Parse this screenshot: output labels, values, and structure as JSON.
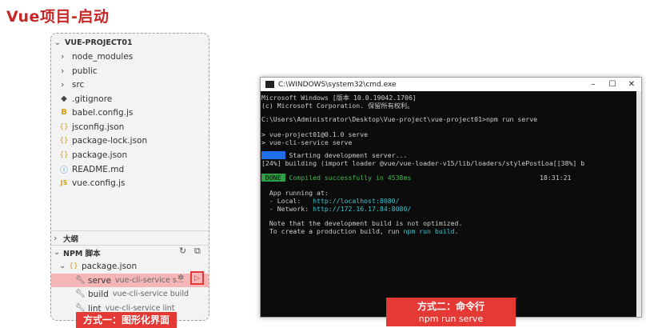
{
  "slide_title": "Vue项目-启动",
  "explorer": {
    "project": "VUE-PROJECT01",
    "items": [
      {
        "label": "node_modules",
        "icon": "›"
      },
      {
        "label": "public",
        "icon": "›"
      },
      {
        "label": "src",
        "icon": "›"
      },
      {
        "label": ".gitignore",
        "icon": "◆"
      },
      {
        "label": "babel.config.js",
        "icon": "B"
      },
      {
        "label": "jsconfig.json",
        "icon": "{}"
      },
      {
        "label": "package-lock.json",
        "icon": "{}"
      },
      {
        "label": "package.json",
        "icon": "{}"
      },
      {
        "label": "README.md",
        "icon": "ⓘ"
      },
      {
        "label": "vue.config.js",
        "icon": "JS"
      }
    ],
    "outline": "大纲",
    "npm_scripts": "NPM 脚本",
    "package_json": "package.json",
    "scripts": [
      {
        "name": "serve",
        "cmd": "vue-cli-service s..."
      },
      {
        "name": "build",
        "cmd": "vue-cli-service build"
      },
      {
        "name": "lint",
        "cmd": "vue-cli-service lint"
      }
    ]
  },
  "labels": {
    "gui": "方式一：图形化界面",
    "cli_title": "方式二：命令行",
    "cli_sub": "npm run serve"
  },
  "cmd_window": {
    "title": "C:\\WINDOWS\\system32\\cmd.exe",
    "lines": {
      "l1": "Microsoft Windows [版本 10.0.19042.1706]",
      "l2": "(c) Microsoft Corporation. 保留所有权利。",
      "l3": "C:\\Users\\Administrator\\Desktop\\Vue-project\\vue-project01>npm run serve",
      "l4": "> vue-project01@0.1.0 serve",
      "l5": "> vue-cli-service serve",
      "l6a": " INFO ",
      "l6b": " Starting development server...",
      "l7": "[24%] building (import loader @vue/vue-loader-v15/lib/loaders/stylePostLoa[[38%] b",
      "l8a": " DONE ",
      "l8b": " Compiled successfully in 4538ms",
      "l8c": "18:31:21",
      "l9": "  App running at:",
      "l10a": "  - Local:   ",
      "l10b": "http://localhost:8080/",
      "l11a": "  - Network: ",
      "l11b": "http://172.16.17.84:8080/",
      "l12": "  Note that the development build is not optimized.",
      "l13a": "  To create a production build, run ",
      "l13b": "npm run build",
      "l13c": "."
    }
  }
}
